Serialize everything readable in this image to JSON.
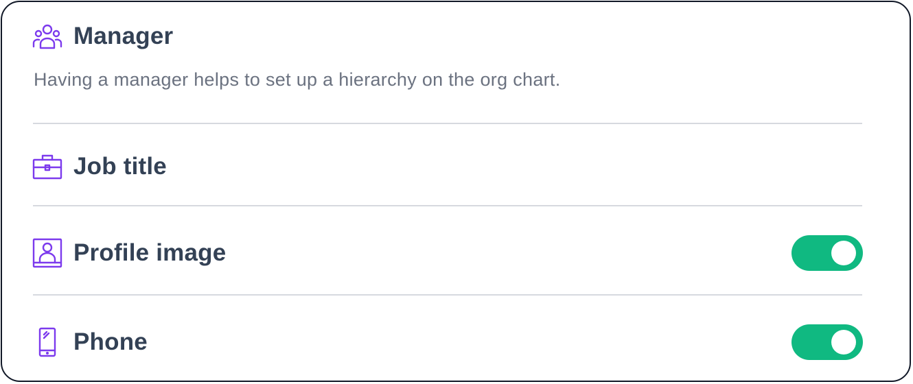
{
  "sections": {
    "manager": {
      "title": "Manager",
      "description": "Having a manager helps to set up a hierarchy on the org chart.",
      "icon": "users-group-icon"
    },
    "job_title": {
      "title": "Job title",
      "icon": "briefcase-icon"
    },
    "profile_image": {
      "title": "Profile image",
      "icon": "profile-image-icon",
      "toggle_on": true
    },
    "phone": {
      "title": "Phone",
      "icon": "phone-icon",
      "toggle_on": true
    }
  },
  "colors": {
    "accent": "#7c3aed",
    "toggle_on": "#10b981",
    "title": "#334155",
    "description": "#6b7280",
    "border": "#111827",
    "divider": "#d6d9df"
  }
}
